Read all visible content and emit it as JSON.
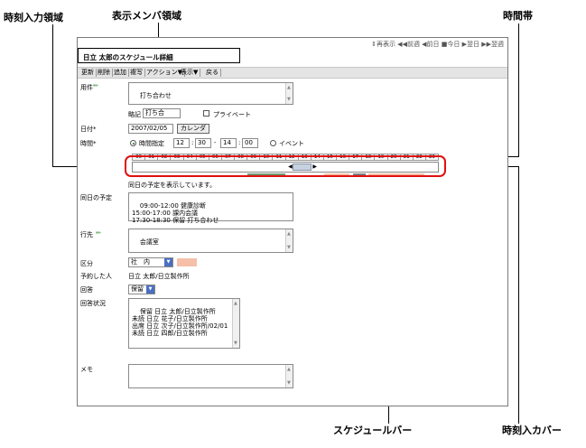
{
  "annotations": {
    "time_input_area": "時刻入力領域",
    "display_member_area": "表示メンバ領域",
    "time_zone": "時間帯",
    "schedule_bar": "スケジュールバー",
    "time_input_cover": "時刻入カバー"
  },
  "topnav": "⇕再表示 ◀◀前週 ◀前日 ■今日 ▶翌日 ▶▶翌週",
  "page_title": "日立 太郎のスケジュール詳細",
  "toolbar": {
    "items": [
      "更新",
      "削除",
      "追加",
      "複写",
      "アクション▼",
      "表示▼",
      "戻る"
    ]
  },
  "form": {
    "subject_label": "用件",
    "subject_value": "打ち合わせ",
    "abbrev_label": "略記",
    "abbrev_value": "打ち合",
    "private_label": "プライベート",
    "date_label": "日付*",
    "date_value": "2007/02/05",
    "calendar_button": "カレンダ",
    "time_label": "時間*",
    "time_mode_label": "時間指定",
    "start_hour": "12",
    "start_min": "30",
    "time_sep": "-",
    "end_hour": "14",
    "end_min": "00",
    "colon": ":",
    "event_label": "イベント",
    "hours": [
      "00",
      "01",
      "02",
      "03",
      "04",
      "05",
      "06",
      "07",
      "08",
      "09",
      "10",
      "11",
      "12",
      "13",
      "14",
      "15",
      "16",
      "17",
      "18",
      "19",
      "20",
      "21",
      "22",
      "23"
    ],
    "selected_start_hour": 12.5,
    "selected_end_hour": 14.0,
    "day_status_note": "同日の予定を表示しています。",
    "same_day_label": "同日の予定",
    "same_day_items": "09:00-12:00 健康診断\n15:00-17:00 課内会議\n17:30-18:30 保留 打ち合わせ",
    "destination_label": "行先",
    "destination_value": "会議室",
    "category_label": "区分",
    "category_value": "社　内",
    "category_color": "#f5bfa8",
    "booker_label": "予約した人",
    "booker_value": "日立 太郎/日立製作所",
    "reply_label": "回答",
    "reply_value": "保留",
    "reply_status_label": "回答状況",
    "reply_status_items": "保留 日立 太郎/日立製作所\n未読 日立 花子/日立製作所\n出席 日立 次子/日立製作所/02/01\n未読 日立 四郎/日立製作所",
    "memo_label": "メモ"
  },
  "colors": {
    "cover_border": "#e01010",
    "legend_gray": "#7f7f7f",
    "legend_green": "#6e9a74",
    "legend_pink": "#f5bfa8"
  }
}
